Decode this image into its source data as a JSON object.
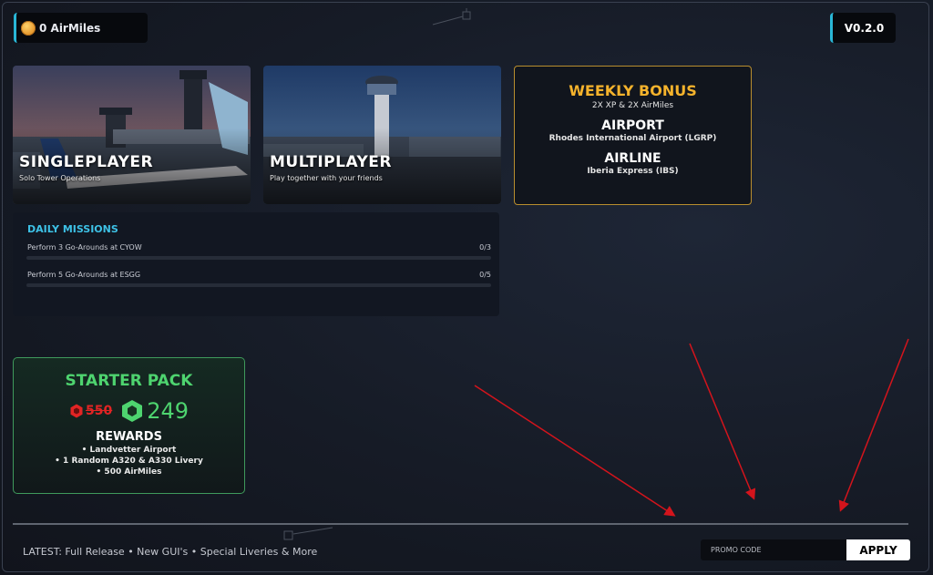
{
  "header": {
    "airmiles_label": "0 AirMiles",
    "version": "V0.2.0"
  },
  "modes": [
    {
      "title": "SINGLEPLAYER",
      "subtitle": "Solo Tower Operations"
    },
    {
      "title": "MULTIPLAYER",
      "subtitle": "Play together with your friends"
    }
  ],
  "weekly_bonus": {
    "title": "WEEKLY BONUS",
    "subtitle": "2X XP & 2X AirMiles",
    "airport_heading": "AIRPORT",
    "airport_value": "Rhodes International Airport (LGRP)",
    "airline_heading": "AIRLINE",
    "airline_value": "Iberia Express (IBS)"
  },
  "daily_missions": {
    "title": "DAILY MISSIONS",
    "items": [
      {
        "label": "Perform 3 Go-Arounds at CYOW",
        "progress": "0/3",
        "fraction": 0
      },
      {
        "label": "Perform 5 Go-Arounds at ESGG",
        "progress": "0/5",
        "fraction": 0
      }
    ]
  },
  "starter_pack": {
    "title": "STARTER PACK",
    "old_price": "550",
    "new_price": "249",
    "rewards_heading": "REWARDS",
    "rewards": [
      "• Landvetter Airport",
      "• 1 Random A320 & A330 Livery",
      "• 500 AirMiles"
    ]
  },
  "footer": {
    "latest": "LATEST: Full Release • New GUI's • Special Liveries & More",
    "promo_placeholder": "PROMO CODE",
    "apply_label": "APPLY"
  },
  "colors": {
    "accent_cyan": "#29b6d6",
    "bonus_gold": "#f5b32c",
    "starter_green": "#4ed46f",
    "old_price_red": "#e22424"
  },
  "icons": [
    "coin-icon",
    "robux-icon"
  ]
}
